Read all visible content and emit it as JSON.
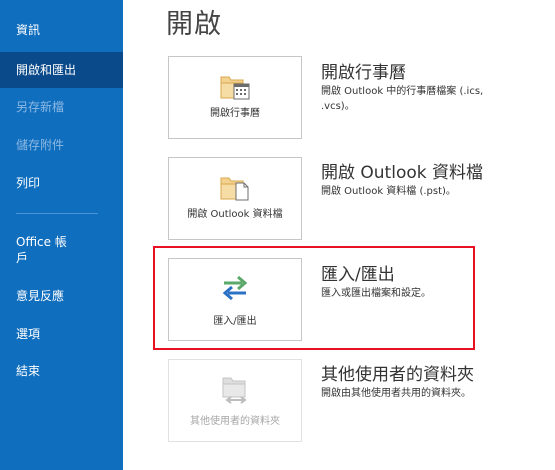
{
  "sidebar": {
    "items": [
      {
        "label": "資訊"
      },
      {
        "label": "開啟和匯出"
      },
      {
        "label": "另存新檔"
      },
      {
        "label": "儲存附件"
      },
      {
        "label": "列印"
      },
      {
        "label": "Office 帳\n戶"
      },
      {
        "label": "意見反應"
      },
      {
        "label": "選項"
      },
      {
        "label": "結束"
      }
    ]
  },
  "main": {
    "title": "開啟",
    "options": [
      {
        "tile_label": "開啟行事曆",
        "title": "開啟行事曆",
        "description": "開啟 Outlook 中的行事曆檔案 (.ics, .vcs)。",
        "icon": "folder-calendar-icon"
      },
      {
        "tile_label": "開啟 Outlook 資料檔",
        "title": "開啟 Outlook 資料檔",
        "description": "開啟 Outlook 資料檔 (.pst)。",
        "icon": "folder-file-icon"
      },
      {
        "tile_label": "匯入/匯出",
        "title": "匯入/匯出",
        "description": "匯入或匯出檔案和設定。",
        "icon": "import-export-arrows-icon"
      },
      {
        "tile_label": "其他使用者的資料夾",
        "title": "其他使用者的資料夾",
        "description": "開啟由其他使用者共用的資料夾。",
        "icon": "shared-folder-icon"
      }
    ]
  },
  "colors": {
    "sidebar_bg": "#106ebe",
    "sidebar_active": "#0a4a8a",
    "highlight": "#e81123",
    "arrow_green": "#5aa96a",
    "arrow_blue": "#2b72c4"
  }
}
